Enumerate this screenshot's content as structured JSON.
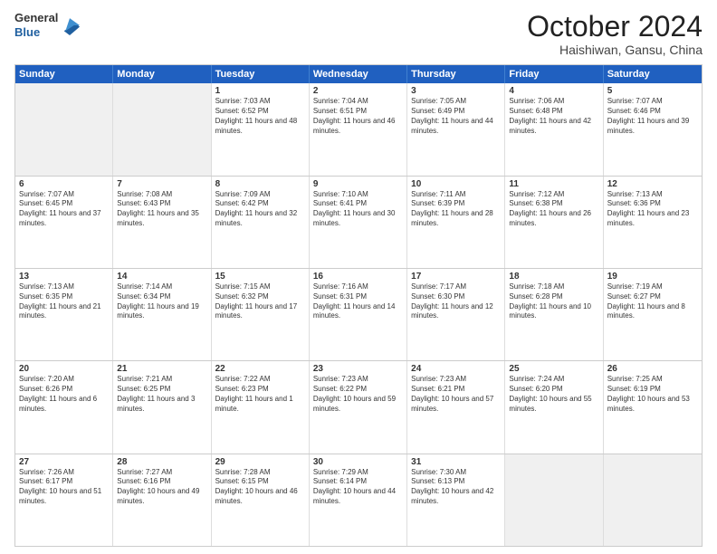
{
  "logo": {
    "general": "General",
    "blue": "Blue"
  },
  "title": {
    "month_year": "October 2024",
    "location": "Haishiwan, Gansu, China"
  },
  "days_of_week": [
    "Sunday",
    "Monday",
    "Tuesday",
    "Wednesday",
    "Thursday",
    "Friday",
    "Saturday"
  ],
  "weeks": [
    [
      {
        "day": "",
        "info": "",
        "shaded": true
      },
      {
        "day": "",
        "info": "",
        "shaded": true
      },
      {
        "day": "1",
        "info": "Sunrise: 7:03 AM\nSunset: 6:52 PM\nDaylight: 11 hours and 48 minutes."
      },
      {
        "day": "2",
        "info": "Sunrise: 7:04 AM\nSunset: 6:51 PM\nDaylight: 11 hours and 46 minutes."
      },
      {
        "day": "3",
        "info": "Sunrise: 7:05 AM\nSunset: 6:49 PM\nDaylight: 11 hours and 44 minutes."
      },
      {
        "day": "4",
        "info": "Sunrise: 7:06 AM\nSunset: 6:48 PM\nDaylight: 11 hours and 42 minutes."
      },
      {
        "day": "5",
        "info": "Sunrise: 7:07 AM\nSunset: 6:46 PM\nDaylight: 11 hours and 39 minutes."
      }
    ],
    [
      {
        "day": "6",
        "info": "Sunrise: 7:07 AM\nSunset: 6:45 PM\nDaylight: 11 hours and 37 minutes."
      },
      {
        "day": "7",
        "info": "Sunrise: 7:08 AM\nSunset: 6:43 PM\nDaylight: 11 hours and 35 minutes."
      },
      {
        "day": "8",
        "info": "Sunrise: 7:09 AM\nSunset: 6:42 PM\nDaylight: 11 hours and 32 minutes."
      },
      {
        "day": "9",
        "info": "Sunrise: 7:10 AM\nSunset: 6:41 PM\nDaylight: 11 hours and 30 minutes."
      },
      {
        "day": "10",
        "info": "Sunrise: 7:11 AM\nSunset: 6:39 PM\nDaylight: 11 hours and 28 minutes."
      },
      {
        "day": "11",
        "info": "Sunrise: 7:12 AM\nSunset: 6:38 PM\nDaylight: 11 hours and 26 minutes."
      },
      {
        "day": "12",
        "info": "Sunrise: 7:13 AM\nSunset: 6:36 PM\nDaylight: 11 hours and 23 minutes."
      }
    ],
    [
      {
        "day": "13",
        "info": "Sunrise: 7:13 AM\nSunset: 6:35 PM\nDaylight: 11 hours and 21 minutes."
      },
      {
        "day": "14",
        "info": "Sunrise: 7:14 AM\nSunset: 6:34 PM\nDaylight: 11 hours and 19 minutes."
      },
      {
        "day": "15",
        "info": "Sunrise: 7:15 AM\nSunset: 6:32 PM\nDaylight: 11 hours and 17 minutes."
      },
      {
        "day": "16",
        "info": "Sunrise: 7:16 AM\nSunset: 6:31 PM\nDaylight: 11 hours and 14 minutes."
      },
      {
        "day": "17",
        "info": "Sunrise: 7:17 AM\nSunset: 6:30 PM\nDaylight: 11 hours and 12 minutes."
      },
      {
        "day": "18",
        "info": "Sunrise: 7:18 AM\nSunset: 6:28 PM\nDaylight: 11 hours and 10 minutes."
      },
      {
        "day": "19",
        "info": "Sunrise: 7:19 AM\nSunset: 6:27 PM\nDaylight: 11 hours and 8 minutes."
      }
    ],
    [
      {
        "day": "20",
        "info": "Sunrise: 7:20 AM\nSunset: 6:26 PM\nDaylight: 11 hours and 6 minutes."
      },
      {
        "day": "21",
        "info": "Sunrise: 7:21 AM\nSunset: 6:25 PM\nDaylight: 11 hours and 3 minutes."
      },
      {
        "day": "22",
        "info": "Sunrise: 7:22 AM\nSunset: 6:23 PM\nDaylight: 11 hours and 1 minute."
      },
      {
        "day": "23",
        "info": "Sunrise: 7:23 AM\nSunset: 6:22 PM\nDaylight: 10 hours and 59 minutes."
      },
      {
        "day": "24",
        "info": "Sunrise: 7:23 AM\nSunset: 6:21 PM\nDaylight: 10 hours and 57 minutes."
      },
      {
        "day": "25",
        "info": "Sunrise: 7:24 AM\nSunset: 6:20 PM\nDaylight: 10 hours and 55 minutes."
      },
      {
        "day": "26",
        "info": "Sunrise: 7:25 AM\nSunset: 6:19 PM\nDaylight: 10 hours and 53 minutes."
      }
    ],
    [
      {
        "day": "27",
        "info": "Sunrise: 7:26 AM\nSunset: 6:17 PM\nDaylight: 10 hours and 51 minutes."
      },
      {
        "day": "28",
        "info": "Sunrise: 7:27 AM\nSunset: 6:16 PM\nDaylight: 10 hours and 49 minutes."
      },
      {
        "day": "29",
        "info": "Sunrise: 7:28 AM\nSunset: 6:15 PM\nDaylight: 10 hours and 46 minutes."
      },
      {
        "day": "30",
        "info": "Sunrise: 7:29 AM\nSunset: 6:14 PM\nDaylight: 10 hours and 44 minutes."
      },
      {
        "day": "31",
        "info": "Sunrise: 7:30 AM\nSunset: 6:13 PM\nDaylight: 10 hours and 42 minutes."
      },
      {
        "day": "",
        "info": "",
        "shaded": true
      },
      {
        "day": "",
        "info": "",
        "shaded": true
      }
    ]
  ]
}
